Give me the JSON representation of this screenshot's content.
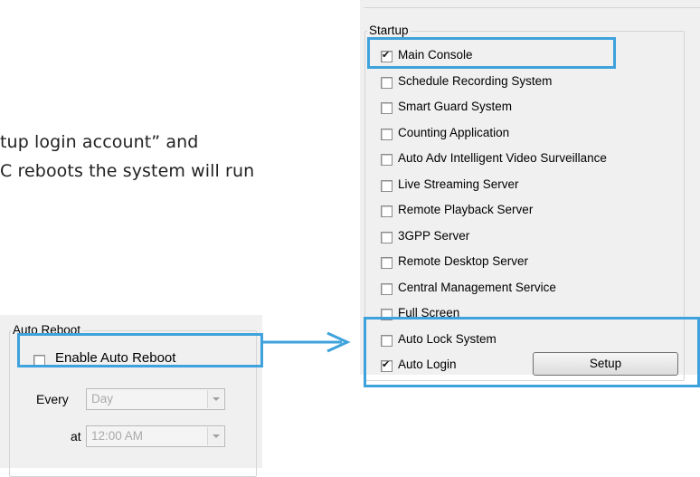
{
  "doc_text": {
    "line1": "tup login account” and",
    "line2": "C reboots the system will run"
  },
  "startup": {
    "group_title": "Startup",
    "items": [
      {
        "label": "Main Console",
        "checked": true
      },
      {
        "label": "Schedule Recording System",
        "checked": false
      },
      {
        "label": "Smart Guard System",
        "checked": false
      },
      {
        "label": "Counting Application",
        "checked": false
      },
      {
        "label": "Auto Adv Intelligent Video Surveillance",
        "checked": false
      },
      {
        "label": "Live Streaming Server",
        "checked": false
      },
      {
        "label": "Remote Playback Server",
        "checked": false
      },
      {
        "label": "3GPP Server",
        "checked": false
      },
      {
        "label": "Remote Desktop Server",
        "checked": false
      },
      {
        "label": "Central Management Service",
        "checked": false
      },
      {
        "label": "Full Screen",
        "checked": false
      },
      {
        "label": "Auto Lock System",
        "checked": false
      },
      {
        "label": "Auto Login",
        "checked": true
      }
    ],
    "setup_button": "Setup"
  },
  "auto_reboot": {
    "group_title": "Auto Reboot",
    "enable_label": "Enable Auto Reboot",
    "enable_checked": false,
    "every_label": "Every",
    "every_value": "Day",
    "at_label": "at",
    "at_value": "12:00 AM"
  },
  "colors": {
    "highlight": "#3ea2dc",
    "panel_bg": "#f0f0f0"
  }
}
